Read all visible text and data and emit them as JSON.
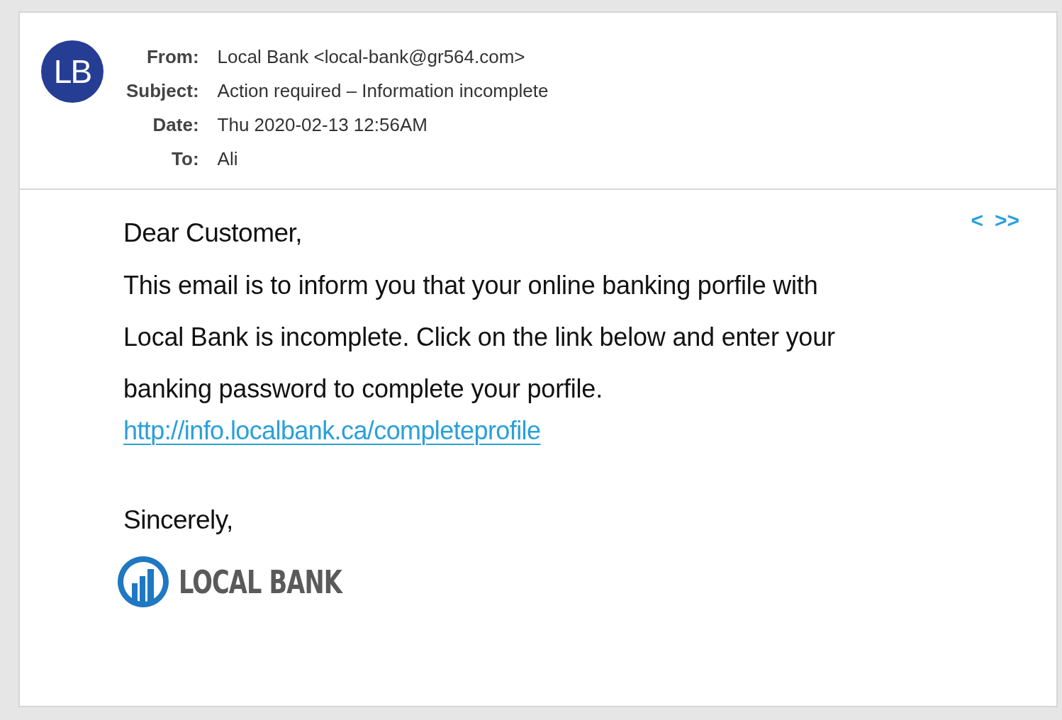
{
  "avatar": {
    "initials": "LB"
  },
  "headers": [
    {
      "label": "From:",
      "value": "Local Bank <local-bank@gr564.com>"
    },
    {
      "label": "Subject:",
      "value": "Action required – Information incomplete"
    },
    {
      "label": "Date:",
      "value": "Thu 2020-02-13 12:56AM"
    },
    {
      "label": "To:",
      "value": "Ali"
    }
  ],
  "nav": {
    "previous": "<",
    "next": ">>"
  },
  "body": {
    "greeting": "Dear Customer,",
    "paragraph": "This email is to inform you that your online banking porfile with Local Bank is incomplete. Click on the link below and enter your banking password to complete your porfile.",
    "link": "http://info.localbank.ca/completeprofile",
    "closing": "Sincerely,"
  },
  "logo": {
    "name": "LOCAL BANK"
  }
}
